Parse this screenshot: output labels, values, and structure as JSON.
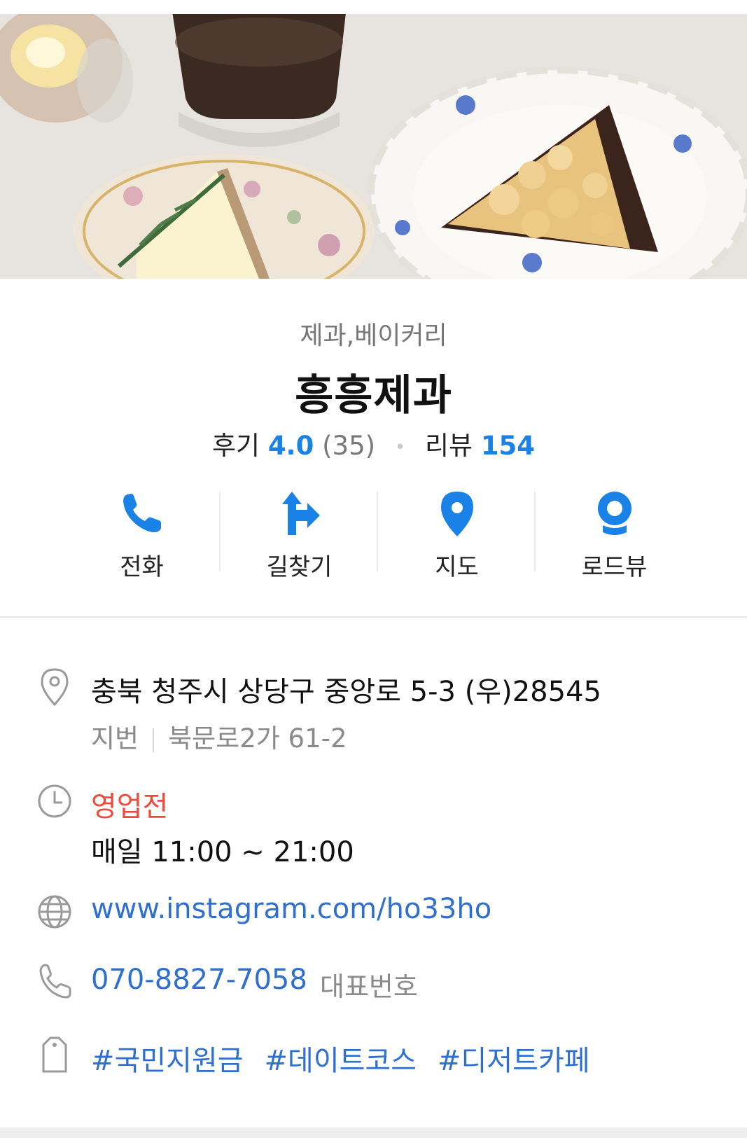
{
  "place": {
    "category": "제과,베이커리",
    "name": "흥흥제과",
    "review_label": "후기",
    "review_score": "4.0",
    "review_count": "(35)",
    "blog_label": "리뷰",
    "blog_count": "154"
  },
  "actions": [
    {
      "label": "전화",
      "icon": "phone-icon"
    },
    {
      "label": "길찾기",
      "icon": "directions-icon"
    },
    {
      "label": "지도",
      "icon": "map-pin-icon"
    },
    {
      "label": "로드뷰",
      "icon": "roadview-icon"
    }
  ],
  "info": {
    "address": "충북 청주시 상당구 중앙로 5-3 (우)28545",
    "jibun_label": "지번",
    "jibun": "북문로2가 61-2",
    "status": "영업전",
    "hours": "매일 11:00 ~ 21:00",
    "website": "www.instagram.com/ho33ho",
    "phone": "070-8827-7058",
    "phone_type": "대표번호",
    "tags": [
      "#국민지원금",
      "#데이트코스",
      "#디저트카페"
    ]
  },
  "colors": {
    "accent_blue": "#1a82e6",
    "link_blue": "#2f6fd0",
    "status_red": "#ec4b3c",
    "muted_gray": "#8a8a8a"
  }
}
